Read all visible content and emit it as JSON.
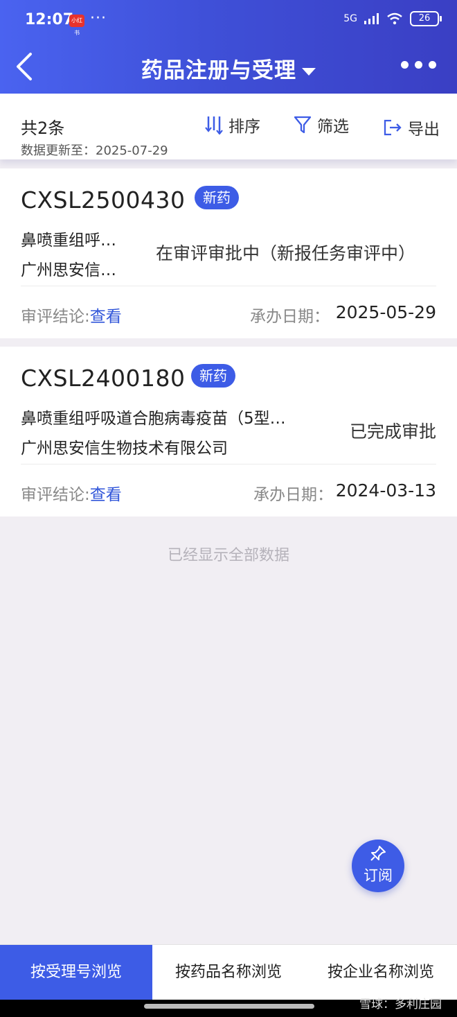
{
  "status": {
    "time": "12:07",
    "app_badge": "小红书",
    "dots": "···",
    "network": "5G",
    "battery": "26"
  },
  "header": {
    "title": "药品注册与受理"
  },
  "summary": {
    "total": "共2条",
    "updated": "数据更新至：2025-07-29",
    "sort_label": "排序",
    "filter_label": "筛选",
    "export_label": "导出"
  },
  "cards": [
    {
      "id": "CXSL2500430",
      "tag": "新药",
      "drug": "鼻喷重组呼…",
      "company": "广州思安信…",
      "status": "在审评审批中（新报任务审评中）",
      "conclusion_label": "审评结论:",
      "conclusion_link": "查看",
      "date_label": "承办日期：",
      "date": "2025-05-29"
    },
    {
      "id": "CXSL2400180",
      "tag": "新药",
      "drug": "鼻喷重组呼吸道合胞病毒疫苗（5型…",
      "company": "广州思安信生物技术有限公司",
      "status": "已完成审批",
      "conclusion_label": "审评结论:",
      "conclusion_link": "查看",
      "date_label": "承办日期：",
      "date": "2024-03-13"
    }
  ],
  "end_note": "已经显示全部数据",
  "fab": {
    "label": "订阅"
  },
  "tabs": [
    "按受理号浏览",
    "按药品名称浏览",
    "按企业名称浏览"
  ],
  "watermark": "雪球：多利庄园",
  "colors": {
    "primary": "#3d5ce6",
    "link": "#3055d9",
    "background": "#f1eef3"
  }
}
